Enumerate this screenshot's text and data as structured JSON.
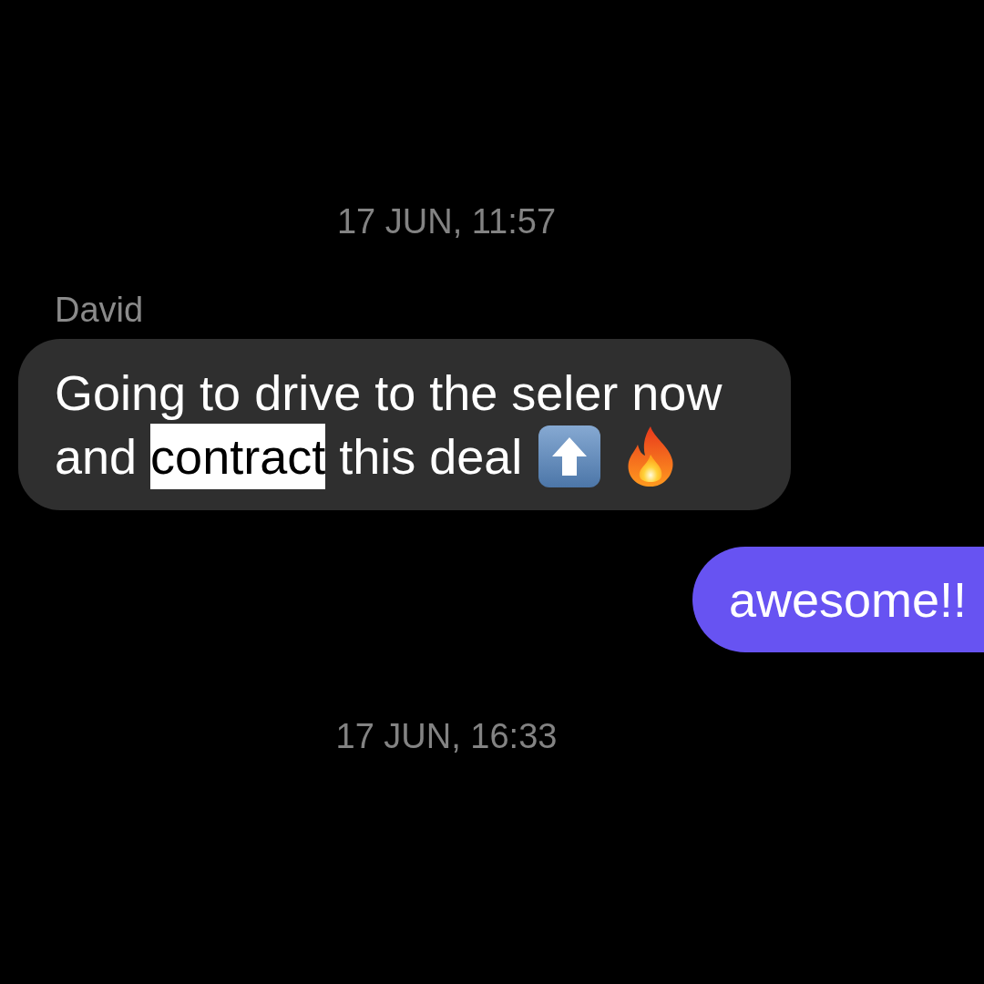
{
  "thread": [
    {
      "kind": "timestamp",
      "text": "17 JUN, 11:57"
    },
    {
      "kind": "incoming",
      "sender": "David",
      "segments": [
        {
          "text": "Going to drive to the seler now and ",
          "highlighted": false
        },
        {
          "text": "contract",
          "highlighted": true
        },
        {
          "text": " this deal",
          "highlighted": false
        }
      ],
      "emojis": [
        {
          "kind": "up_arrow"
        },
        {
          "kind": "fire"
        }
      ]
    },
    {
      "kind": "outgoing",
      "segments": [
        {
          "text": "awesome!!",
          "highlighted": false
        }
      ]
    },
    {
      "kind": "timestamp",
      "text": "17 JUN, 16:33"
    }
  ]
}
